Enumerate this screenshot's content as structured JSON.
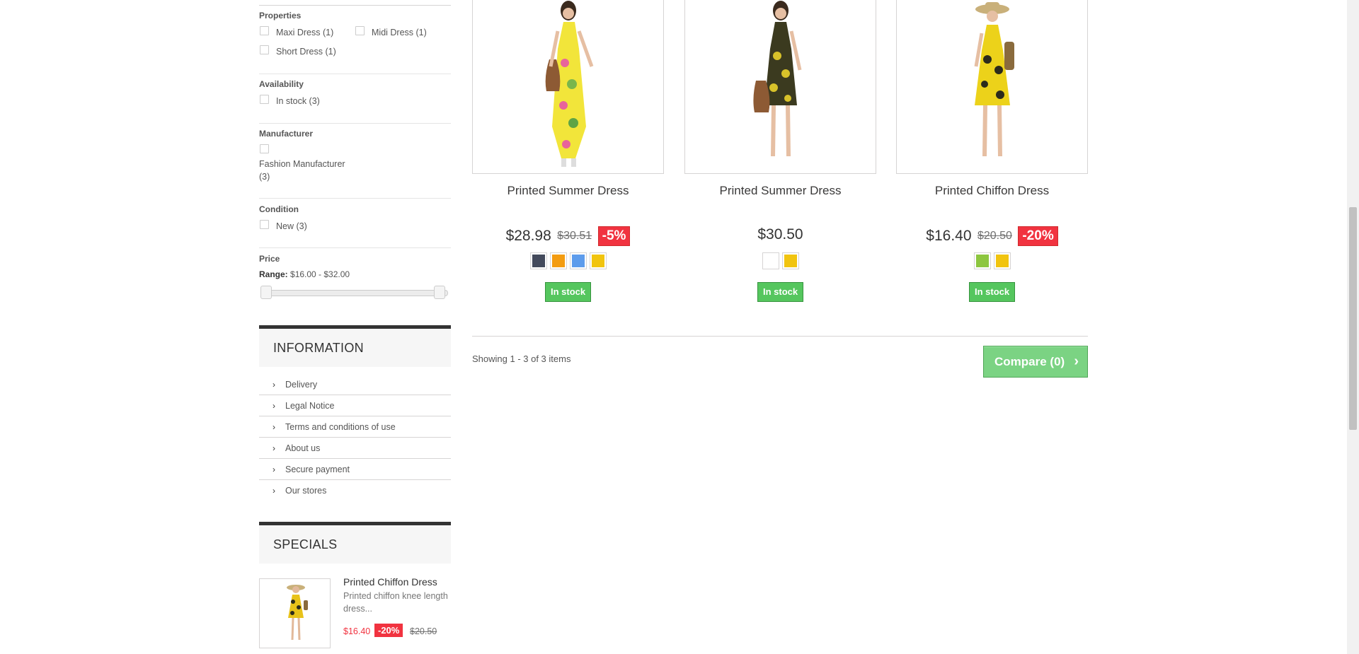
{
  "filters": {
    "properties": {
      "title": "Properties",
      "options": [
        "Maxi Dress (1)",
        "Midi Dress (1)",
        "Short Dress (1)"
      ]
    },
    "availability": {
      "title": "Availability",
      "options": [
        "In stock (3)"
      ]
    },
    "manufacturer": {
      "title": "Manufacturer",
      "option_line1": "Fashion Manufacturer",
      "option_line2": "(3)"
    },
    "condition": {
      "title": "Condition",
      "options": [
        "New (3)"
      ]
    },
    "price": {
      "title": "Price",
      "range_label": "Range:",
      "range_value": "$16.00 - $32.00"
    }
  },
  "information": {
    "title": "INFORMATION",
    "links": [
      "Delivery",
      "Legal Notice",
      "Terms and conditions of use",
      "About us",
      "Secure payment",
      "Our stores"
    ]
  },
  "specials": {
    "title": "SPECIALS",
    "product": {
      "name": "Printed Chiffon Dress",
      "description": "Printed chiffon knee length dress...",
      "price": "$16.40",
      "discount": "-20%",
      "old_price": "$20.50"
    }
  },
  "products": [
    {
      "name": "Printed Summer Dress",
      "price": "$28.98",
      "old_price": "$30.51",
      "discount": "-5%",
      "colors": [
        "#434a5c",
        "#f39c11",
        "#5d9cec",
        "#f1c40f"
      ],
      "stock": "In stock"
    },
    {
      "name": "Printed Summer Dress",
      "price": "$30.50",
      "old_price": "",
      "discount": "",
      "colors": [
        "#ffffff",
        "#f1c40f"
      ],
      "stock": "In stock"
    },
    {
      "name": "Printed Chiffon Dress",
      "price": "$16.40",
      "old_price": "$20.50",
      "discount": "-20%",
      "colors": [
        "#8dc63f",
        "#f1c40f"
      ],
      "stock": "In stock"
    }
  ],
  "listing": {
    "showing": "Showing 1 - 3 of 3 items",
    "compare": "Compare (0)"
  }
}
